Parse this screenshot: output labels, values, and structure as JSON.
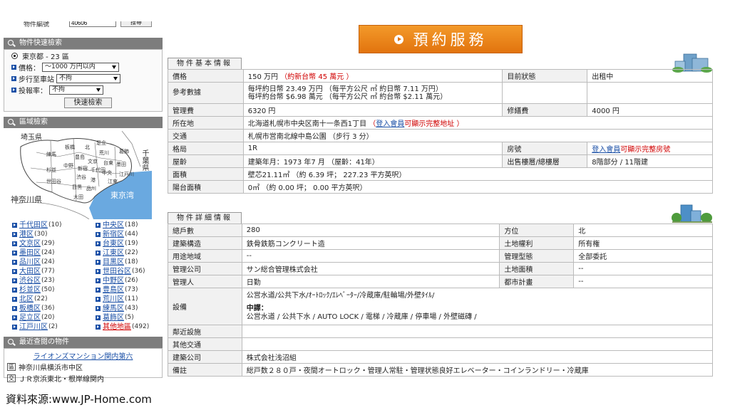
{
  "sidebar": {
    "top_label": "物件編號",
    "top_value": "40606",
    "top_button": "搜尋",
    "quick_search": {
      "title": "物件快速檢索",
      "area": "東京都 - 23 區",
      "price_label": "價格",
      "price_value": "～1000 万円以内",
      "walk_label": "步行至車站",
      "walk_value": "不拘",
      "yield_label": "投報率",
      "yield_value": "不拘",
      "button": "快速檢索"
    },
    "area_search": {
      "title": "區域檢索",
      "map_labels": {
        "saitama": "埼玉県",
        "chiba": "千葉県",
        "kanagawa": "神奈川県",
        "tokyo_bay": "東京湾",
        "nerima": "練馬",
        "itabashi": "板橋",
        "kita": "北",
        "adachi": "足立",
        "katsushika": "葛飾",
        "arakawa": "荒川",
        "toshima": "豊島",
        "bunkyo": "文京",
        "taito": "台東",
        "sumida": "墨田",
        "edogawa": "江戸川",
        "nakano": "中野",
        "shinjuku": "新宿",
        "chiyoda": "千代田",
        "suginami": "杉並",
        "shibuya": "渋谷",
        "chuo": "中央",
        "koto": "江東",
        "setagaya": "世田谷",
        "minato": "港",
        "meguro": "目黒",
        "shinagawa": "品川",
        "ota": "大田"
      }
    },
    "wards": [
      {
        "name": "千代田区",
        "count": "(10)"
      },
      {
        "name": "中央区",
        "count": "(18)"
      },
      {
        "name": "港区",
        "count": "(30)"
      },
      {
        "name": "新宿区",
        "count": "(44)"
      },
      {
        "name": "文京区",
        "count": "(29)"
      },
      {
        "name": "台東区",
        "count": "(19)"
      },
      {
        "name": "墨田区",
        "count": "(24)"
      },
      {
        "name": "江東区",
        "count": "(22)"
      },
      {
        "name": "品川区",
        "count": "(24)"
      },
      {
        "name": "目黒区",
        "count": "(18)"
      },
      {
        "name": "大田区",
        "count": "(77)"
      },
      {
        "name": "世田谷区",
        "count": "(36)"
      },
      {
        "name": "渋谷区",
        "count": "(23)"
      },
      {
        "name": "中野区",
        "count": "(26)"
      },
      {
        "name": "杉並区",
        "count": "(50)"
      },
      {
        "name": "豊島区",
        "count": "(73)"
      },
      {
        "name": "北区",
        "count": "(22)"
      },
      {
        "name": "荒川区",
        "count": "(11)"
      },
      {
        "name": "板橋区",
        "count": "(36)"
      },
      {
        "name": "練馬区",
        "count": "(43)"
      },
      {
        "name": "足立区",
        "count": "(20)"
      },
      {
        "name": "葛飾区",
        "count": "(5)"
      },
      {
        "name": "江戸川区",
        "count": "(2)"
      },
      {
        "name": "其他地區",
        "count": "(492)"
      }
    ],
    "recent": {
      "title": "最近查閱の物件",
      "item_title": "ライオンズマンション関内第六",
      "row1_key": "區",
      "row1_value": "神奈川県横浜市中区",
      "row2_key": "交",
      "row2_value": "ＪＲ京浜東北・根岸線関内"
    }
  },
  "main": {
    "reserve_button": "預約服務",
    "basic": {
      "tab": "物件基本情報",
      "price_label": "價格",
      "price_value": "150 万円",
      "price_twd": "（約新台幣 45 萬元 ）",
      "status_label": "目前狀態",
      "status_value": "出租中",
      "ref_label": "參考數據",
      "ref_line1": "每坪約日幣 23.49 万円 （每平方公尺 ㎡ 約日幣 7.11 万円）",
      "ref_line2": "每坪約台幣 $6.98 萬元 （每平方公尺 ㎡ 約台幣 $2.11 萬元）",
      "mgmt_label": "管理費",
      "mgmt_value": "6320 円",
      "repair_label": "修繕費",
      "repair_value": "4000 円",
      "addr_label": "所在地",
      "addr_value": "北海道札幌市中央区南十一条西1丁目",
      "addr_note_pre": "（",
      "login_link": "登入會員",
      "addr_note": "可顯示完整地址 ）",
      "transport_label": "交通",
      "transport_value": "札幌市営南北線中島公園 （步行 3 分）",
      "layout_label": "格局",
      "layout_value": "1R",
      "room_label": "房號",
      "room_note": "可顯示完整房號",
      "age_label": "屋齡",
      "age_value": "建築年月：1973 年7 月 （屋齡：41年）",
      "floor_label": "出售樓層/總樓層",
      "floor_value": "8階部分 / 11階建",
      "area_label": "面積",
      "area_value": "壁芯21.11㎡ （約 6.39 坪； 227.23 平方英呎）",
      "balcony_label": "陽台面積",
      "balcony_value": "0㎡ （約 0.00 坪； 0.00 平方英呎）"
    },
    "detail": {
      "tab": "物件詳細情報",
      "units_label": "總戶數",
      "units_value": "280",
      "dir_label": "方位",
      "dir_value": "北",
      "struct_label": "建築構造",
      "struct_value": "鉄骨鉄筋コンクリート造",
      "land_right_label": "土地權利",
      "land_right_value": "所有権",
      "zone_label": "用途地域",
      "zone_value": "--",
      "mgmt_type_label": "管理型態",
      "mgmt_type_value": "全部委託",
      "mgmt_co_label": "管理公司",
      "mgmt_co_value": "サン総合管理株式会社",
      "land_area_label": "土地面積",
      "land_area_value": "--",
      "manager_label": "管理人",
      "manager_value": "日勤",
      "city_plan_label": "都市計畫",
      "city_plan_value": "--",
      "equip_label": "設備",
      "equip_value": "公営水道/公共下水/ｵｰﾄﾛｯｸ/ｴﾚﾍﾞｰﾀｰ/冷蔵庫/駐輪場/外壁ﾀｲﾙ/",
      "equip_cn_title": "中譯：",
      "equip_cn_value": "公営水道 / 公共下水 / AUTO LOCK / 電梯 / 冷蔵庫 / 停車場 / 外壁磁磚 /",
      "nearby_label": "鄰近設施",
      "other_transport_label": "其他交通",
      "builder_label": "建築公司",
      "builder_value": "株式会社浅沼組",
      "notes_label": "備註",
      "notes_value": "総戸数２８０戸・夜間オートロック・管理人常駐・管理状態良好エレベーター・コインランドリー・冷蔵庫"
    }
  },
  "footer": {
    "source": "資料來源:www.JP-Home.com"
  },
  "colors": {
    "accent_orange": "#e8841a",
    "link_blue": "#1a4fa6",
    "alert_red": "#d00000",
    "header_gray": "#7d7d7d"
  }
}
